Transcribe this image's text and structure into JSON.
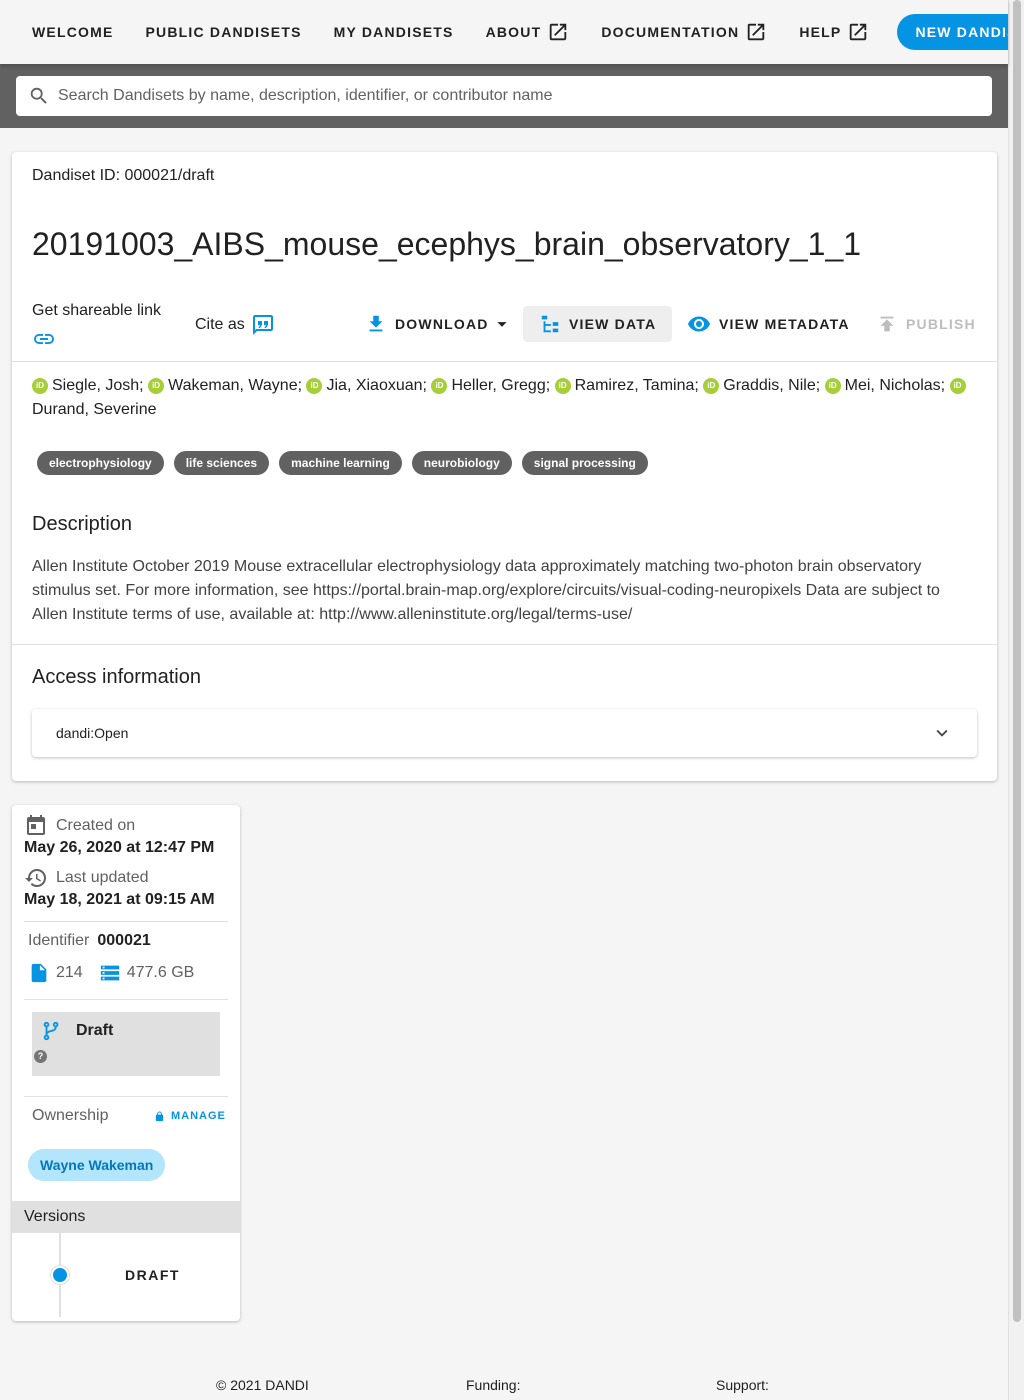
{
  "nav": {
    "welcome": "WELCOME",
    "public": "PUBLIC DANDISETS",
    "my": "MY DANDISETS",
    "about": "ABOUT",
    "docs": "DOCUMENTATION",
    "help": "HELP",
    "new_dandiset": "NEW DANDISET"
  },
  "search": {
    "placeholder": "Search Dandisets by name, description, identifier, or contributor name"
  },
  "dandiset": {
    "id_line": "Dandiset ID: 000021/draft",
    "title": "20191003_AIBS_mouse_ecephys_brain_observatory_1_1",
    "share_label": "Get shareable link",
    "cite_label": "Cite as",
    "actions": {
      "download": "DOWNLOAD",
      "view_data": "VIEW DATA",
      "view_metadata": "VIEW METADATA",
      "publish": "PUBLISH"
    },
    "authors": [
      "Siegle, Josh;",
      "Wakeman, Wayne;",
      "Jia, Xiaoxuan;",
      "Heller, Gregg;",
      "Ramirez, Tamina;",
      "Graddis, Nile;",
      "Mei, Nicholas;",
      "Durand, Severine"
    ],
    "keywords": [
      "electrophysiology",
      "life sciences",
      "machine learning",
      "neurobiology",
      "signal processing"
    ],
    "description_heading": "Description",
    "description": "Allen Institute October 2019 Mouse extracellular electrophysiology data approximately matching two-photon brain observatory stimulus set. For more information, see https://portal.brain-map.org/explore/circuits/visual-coding-neuropixels Data are subject to Allen Institute terms of use, available at: http://www.alleninstitute.org/legal/terms-use/",
    "access_heading": "Access information",
    "access_value": "dandi:Open"
  },
  "sidebar": {
    "created_label": "Created on",
    "created_date": "May 26, 2020 at 12:47 PM",
    "updated_label": "Last updated",
    "updated_date": "May 18, 2021 at 09:15 AM",
    "identifier_label": "Identifier",
    "identifier_value": "000021",
    "file_count": "214",
    "size": "477.6 GB",
    "draft_label": "Draft",
    "ownership_label": "Ownership",
    "manage_label": "MANAGE",
    "owner": "Wayne Wakeman",
    "versions_heading": "Versions",
    "version_label": "DRAFT"
  },
  "footer": {
    "copyright": "© 2021 DANDI",
    "funding": "Funding:",
    "support": "Support:"
  },
  "colors": {
    "primary": "#0593e4",
    "orcid": "#a6ce39",
    "chip": "#616161"
  }
}
